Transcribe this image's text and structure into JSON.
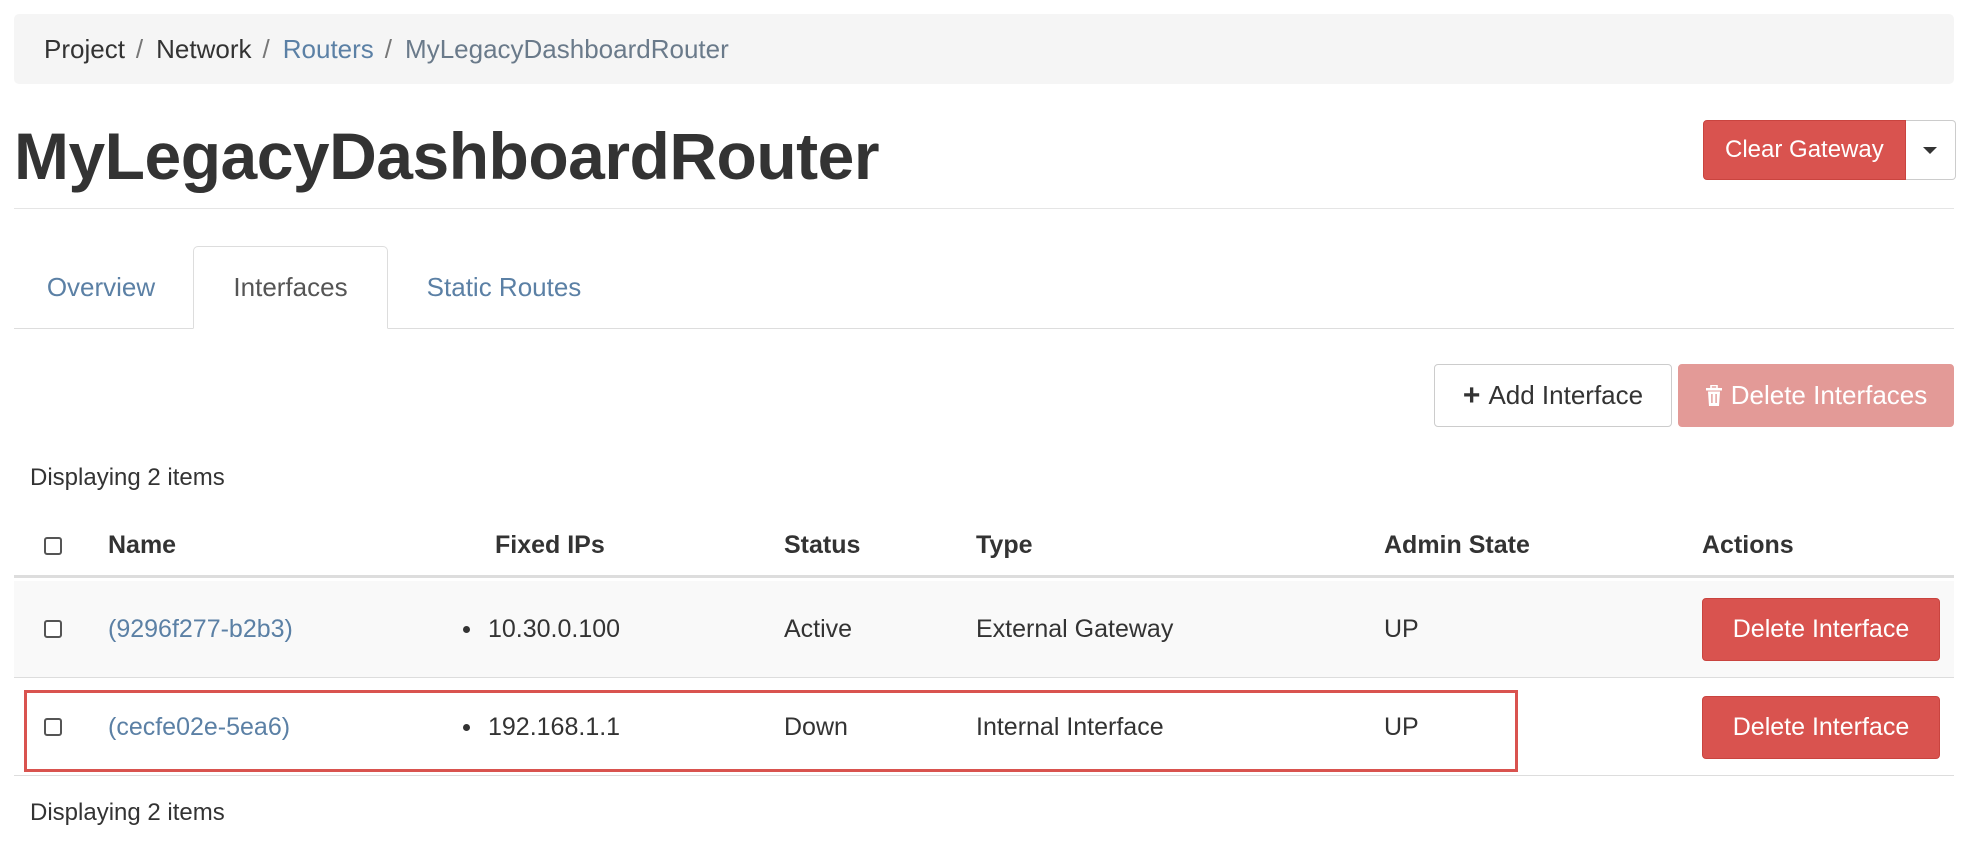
{
  "breadcrumb": {
    "items": [
      {
        "label": "Project"
      },
      {
        "label": "Network"
      },
      {
        "label": "Routers"
      },
      {
        "label": "MyLegacyDashboardRouter"
      }
    ],
    "separator": "/"
  },
  "page": {
    "title": "MyLegacyDashboardRouter",
    "clear_gateway_label": "Clear Gateway"
  },
  "tabs": [
    {
      "label": "Overview"
    },
    {
      "label": "Interfaces",
      "active": true
    },
    {
      "label": "Static Routes"
    }
  ],
  "table_actions": {
    "add_label": "Add Interface",
    "delete_label": "Delete Interfaces"
  },
  "table": {
    "count_text": "Displaying 2 items",
    "headers": {
      "name": "Name",
      "fixed_ips": "Fixed IPs",
      "status": "Status",
      "type": "Type",
      "admin_state": "Admin State",
      "actions": "Actions"
    },
    "rows": [
      {
        "name": "(9296f277-b2b3)",
        "fixed_ip": "10.30.0.100",
        "status": "Active",
        "type": "External Gateway",
        "admin_state": "UP",
        "action_label": "Delete Interface"
      },
      {
        "name": "(cecfe02e-5ea6)",
        "fixed_ip": "192.168.1.1",
        "status": "Down",
        "type": "Internal Interface",
        "admin_state": "UP",
        "action_label": "Delete Interface"
      }
    ]
  },
  "colors": {
    "danger": "#d9534f",
    "danger_disabled": "#e39a97",
    "link": "#5b80a5",
    "highlight": "#d9534f"
  },
  "icons": {
    "add": "plus-icon",
    "delete": "trash-icon",
    "dropdown": "caret-down-icon"
  }
}
